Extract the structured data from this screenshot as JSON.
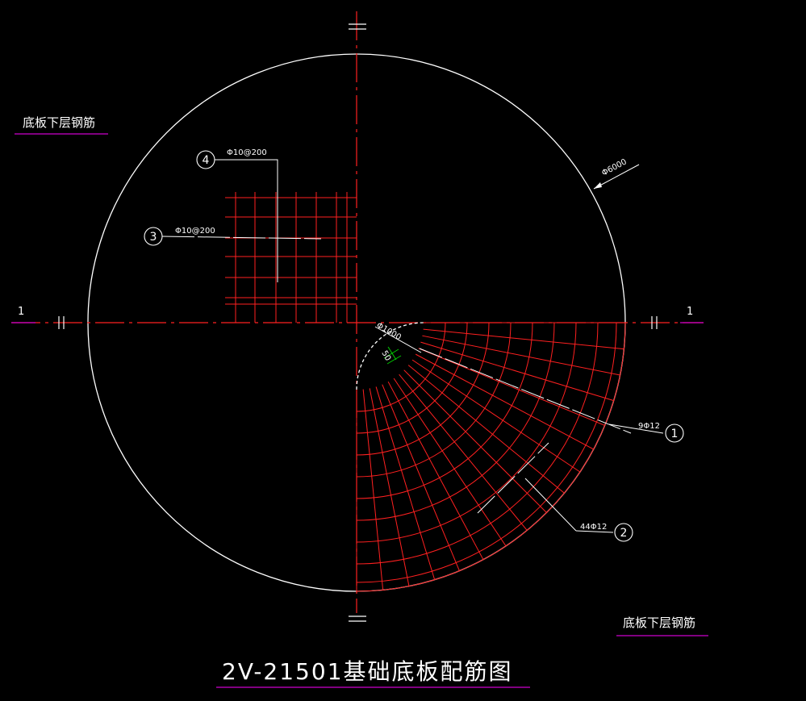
{
  "drawing": {
    "title": "2V-21501基础底板配筋图",
    "note_top_left": "底板下层钢筋",
    "note_bottom_right": "底板下层钢筋",
    "section_left": "1",
    "section_right": "1",
    "dim_outer_diameter": "Φ6000",
    "dim_inner_diameter": "Φ1000",
    "dim_offset": "50",
    "colors": {
      "background": "#000000",
      "outline": "#ffffff",
      "rebar": "#ff2020",
      "underline": "#cc00cc",
      "dimension": "#00cc00"
    }
  },
  "rebar_marks": [
    {
      "id": "1",
      "label": "9Φ12"
    },
    {
      "id": "2",
      "label": "44Φ12"
    },
    {
      "id": "3",
      "label": "Φ10@200"
    },
    {
      "id": "4",
      "label": "Φ10@200"
    }
  ]
}
